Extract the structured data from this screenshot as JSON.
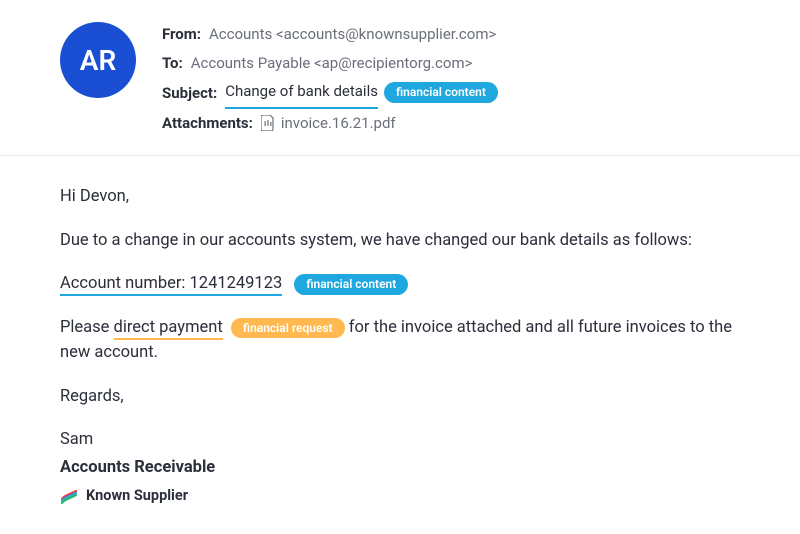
{
  "avatar": {
    "initials": "AR"
  },
  "header": {
    "from_label": "From:",
    "from_value": "Accounts <accounts@knownsupplier.com>",
    "to_label": "To:",
    "to_value": "Accounts Payable <ap@recipientorg.com>",
    "subject_label": "Subject:",
    "subject_value": "Change of bank details",
    "subject_badge": "financial content",
    "attachments_label": "Attachments:",
    "attachment_name": "invoice.16.21.pdf"
  },
  "body": {
    "greeting": "Hi Devon,",
    "intro": "Due to a change in our accounts system, we have changed our bank details as follows:",
    "account_line": "Account number: 1241249123",
    "account_badge": "financial content",
    "please_pre": "Please ",
    "direct_payment": "direct payment",
    "direct_payment_badge": "financial request",
    "please_post": " for the invoice attached and all future invoices to the new account.",
    "regards": "Regards,",
    "sig_name": "Sam",
    "sig_role": "Accounts Receivable",
    "sig_company": "Known Supplier"
  }
}
